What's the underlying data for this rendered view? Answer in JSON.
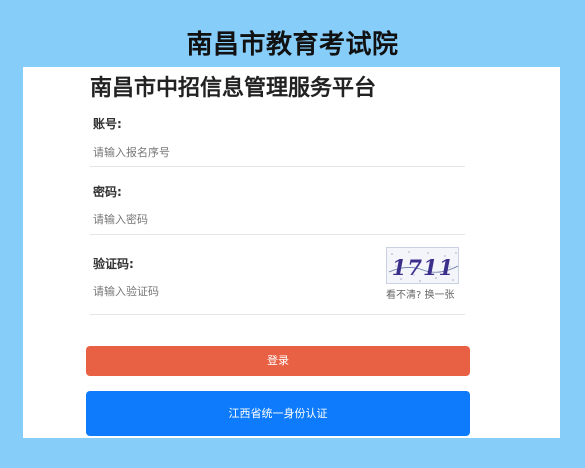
{
  "header": {
    "site_title": "南昌市教育考试院"
  },
  "form": {
    "title": "南昌市中招信息管理服务平台",
    "account": {
      "label": "账号:",
      "placeholder": "请输入报名序号",
      "value": ""
    },
    "password": {
      "label": "密码:",
      "placeholder": "请输入密码",
      "value": ""
    },
    "captcha": {
      "label": "验证码:",
      "placeholder": "请输入验证码",
      "value": "",
      "image_text": "1711",
      "refresh_text": "看不清? 换一张"
    },
    "login_button": "登录",
    "unified_auth_button": "江西省统一身份认证"
  },
  "colors": {
    "background": "#87cdfa",
    "login_button": "#e96145",
    "auth_button": "#0d7bfc"
  }
}
